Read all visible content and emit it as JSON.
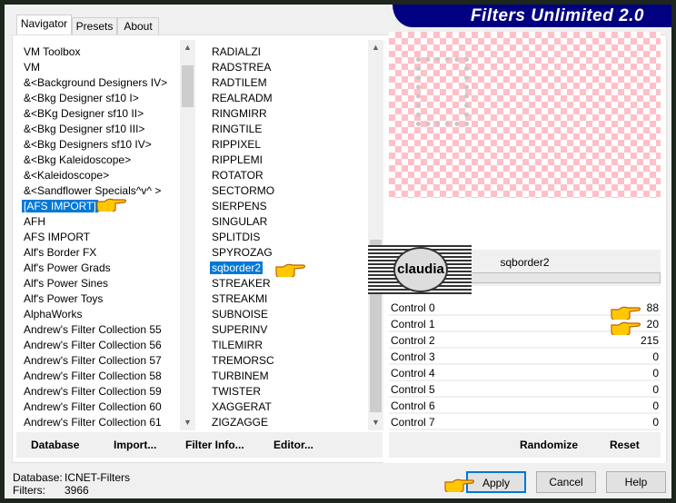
{
  "window": {
    "title": "Filters Unlimited 2.0"
  },
  "tabs": [
    {
      "label": "Navigator",
      "active": true
    },
    {
      "label": "Presets"
    },
    {
      "label": "About"
    }
  ],
  "categories": [
    "VM Toolbox",
    "VM",
    "&<Background Designers IV>",
    "&<Bkg Designer sf10 I>",
    "&<BKg Designer sf10 II>",
    "&<Bkg Designer sf10 III>",
    "&<Bkg Designers sf10 IV>",
    "&<Bkg Kaleidoscope>",
    "&<Kaleidoscope>",
    "&<Sandflower Specials^v^ >",
    "[AFS IMPORT]",
    "AFH",
    "AFS IMPORT",
    "Alf's Border FX",
    "Alf's Power Grads",
    "Alf's Power Sines",
    "Alf's Power Toys",
    "AlphaWorks",
    "Andrew's Filter Collection 55",
    "Andrew's Filter Collection 56",
    "Andrew's Filter Collection 57",
    "Andrew's Filter Collection 58",
    "Andrew's Filter Collection 59",
    "Andrew's Filter Collection 60",
    "Andrew's Filter Collection 61"
  ],
  "selected_category": "[AFS IMPORT]",
  "filters": [
    "RADIALZI",
    "RADSTREA",
    "RADTILEM",
    "REALRADM",
    "RINGMIRR",
    "RINGTILE",
    "RIPPIXEL",
    "RIPPLEMI",
    "ROTATOR",
    "SECTORMO",
    "SIERPENS",
    "SINGULAR",
    "SPLITDIS",
    "SPYROZAG",
    "sqborder2",
    "STREAKER",
    "STREAKMI",
    "SUBNOISE",
    "SUPERINV",
    "TILEMIRR",
    "TREMORSC",
    "TURBINEM",
    "TWISTER",
    "XAGGERAT",
    "ZIGZAGGE"
  ],
  "selected_filter": "sqborder2",
  "filter_name": "sqborder2",
  "controls": [
    {
      "label": "Control 0",
      "value": "88"
    },
    {
      "label": "Control 1",
      "value": "20"
    },
    {
      "label": "Control 2",
      "value": "215"
    },
    {
      "label": "Control 3",
      "value": "0"
    },
    {
      "label": "Control 4",
      "value": "0"
    },
    {
      "label": "Control 5",
      "value": "0"
    },
    {
      "label": "Control 6",
      "value": "0"
    },
    {
      "label": "Control 7",
      "value": "0"
    }
  ],
  "buttons": {
    "database": "Database",
    "import": "Import...",
    "filter_info": "Filter Info...",
    "editor": "Editor...",
    "randomize": "Randomize",
    "reset": "Reset",
    "apply": "Apply",
    "cancel": "Cancel",
    "help": "Help"
  },
  "status": {
    "database_label": "Database:",
    "database_value": "ICNET-Filters",
    "filters_label": "Filters:",
    "filters_value": "3966"
  },
  "watermark": "claudia",
  "colors": {
    "title_bar": "#000080",
    "selection": "#0078d7",
    "preview_checker": "#ffc0c8"
  }
}
